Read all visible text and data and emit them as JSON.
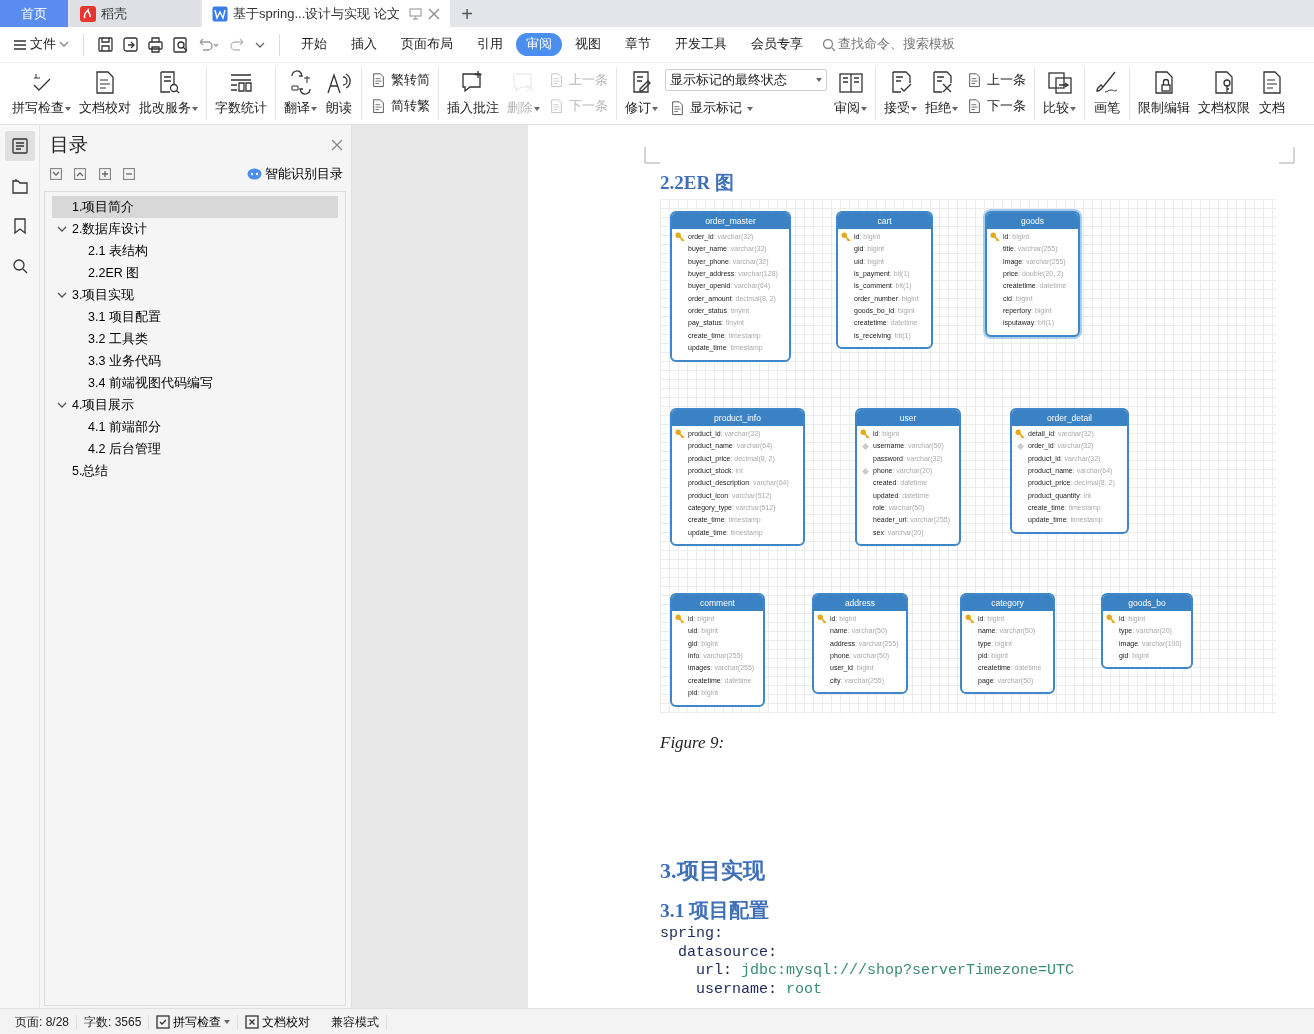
{
  "tabs": [
    {
      "label": "首页",
      "kind": "home",
      "selected": false
    },
    {
      "label": "稻壳",
      "kind": "app",
      "selected": false
    },
    {
      "label": "基于spring...设计与实现 论文",
      "kind": "doc",
      "selected": true
    }
  ],
  "new_tab": "+",
  "menu": {
    "file": "文件",
    "tabs": [
      {
        "label": "开始",
        "selected": false
      },
      {
        "label": "插入",
        "selected": false
      },
      {
        "label": "页面布局",
        "selected": false
      },
      {
        "label": "引用",
        "selected": false
      },
      {
        "label": "审阅",
        "selected": true
      },
      {
        "label": "视图",
        "selected": false
      },
      {
        "label": "章节",
        "selected": false
      },
      {
        "label": "开发工具",
        "selected": false
      },
      {
        "label": "会员专享",
        "selected": false
      }
    ],
    "search_placeholder": "查找命令、搜索模板"
  },
  "ribbon": [
    {
      "items": [
        {
          "kind": "large",
          "label": "拼写检查",
          "dropdown": true,
          "disabled": false
        },
        {
          "kind": "large",
          "label": "文档校对",
          "dropdown": false,
          "disabled": false
        },
        {
          "kind": "large",
          "label": "批改服务",
          "dropdown": true,
          "disabled": false
        }
      ]
    },
    {
      "items": [
        {
          "kind": "large",
          "label": "字数统计",
          "dropdown": false,
          "disabled": false
        }
      ]
    },
    {
      "items": [
        {
          "kind": "large",
          "label": "翻译",
          "dropdown": true,
          "disabled": false
        },
        {
          "kind": "large",
          "label": "朗读",
          "dropdown": false,
          "disabled": false
        }
      ]
    },
    {
      "items": [
        {
          "kind": "pair",
          "items": [
            {
              "label": "繁转简",
              "dropdown": false,
              "disabled": false
            },
            {
              "label": "简转繁",
              "dropdown": false,
              "disabled": false
            }
          ]
        }
      ]
    },
    {
      "items": [
        {
          "kind": "large",
          "label": "插入批注",
          "dropdown": false,
          "disabled": false
        },
        {
          "kind": "large",
          "label": "删除",
          "dropdown": true,
          "disabled": true
        },
        {
          "kind": "pair",
          "items": [
            {
              "label": "上一条",
              "dropdown": false,
              "disabled": true
            },
            {
              "label": "下一条",
              "dropdown": false,
              "disabled": true
            }
          ]
        }
      ]
    },
    {
      "items": [
        {
          "kind": "large",
          "label": "修订",
          "dropdown": true,
          "disabled": false
        },
        {
          "kind": "select",
          "value": "显示标记的最终状态",
          "item": {
            "label": "显示标记",
            "dropdown": true,
            "disabled": false
          }
        },
        {
          "kind": "large",
          "label": "审阅",
          "dropdown": true,
          "disabled": false
        }
      ]
    },
    {
      "items": [
        {
          "kind": "large",
          "label": "接受",
          "dropdown": true,
          "disabled": false
        },
        {
          "kind": "large",
          "label": "拒绝",
          "dropdown": true,
          "disabled": false
        },
        {
          "kind": "pair",
          "items": [
            {
              "label": "上一条",
              "dropdown": false,
              "disabled": false
            },
            {
              "label": "下一条",
              "dropdown": false,
              "disabled": false
            }
          ]
        }
      ]
    },
    {
      "items": [
        {
          "kind": "large",
          "label": "比较",
          "dropdown": true,
          "disabled": false
        }
      ]
    },
    {
      "items": [
        {
          "kind": "large",
          "label": "画笔",
          "dropdown": false,
          "disabled": false
        }
      ]
    },
    {
      "items": [
        {
          "kind": "large",
          "label": "限制编辑",
          "dropdown": false,
          "disabled": false
        },
        {
          "kind": "large",
          "label": "文档权限",
          "dropdown": false,
          "disabled": false
        },
        {
          "kind": "large",
          "label": "文档",
          "dropdown": false,
          "disabled": false
        }
      ]
    }
  ],
  "rail": [
    {
      "selected": true
    },
    {
      "selected": false
    },
    {
      "selected": false
    },
    {
      "selected": false
    }
  ],
  "sidebar": {
    "title": "目录",
    "smart_toc": "智能识别目录",
    "toc": [
      {
        "label": "1.项目简介",
        "selected": true
      },
      {
        "label": "2.数据库设计",
        "selected": false,
        "expanded": true,
        "children": [
          {
            "label": "2.1 表结构",
            "selected": false
          },
          {
            "label": "2.2ER 图",
            "selected": false
          }
        ]
      },
      {
        "label": "3.项目实现",
        "selected": false,
        "expanded": true,
        "children": [
          {
            "label": "3.1 项目配置",
            "selected": false
          },
          {
            "label": "3.2 工具类",
            "selected": false
          },
          {
            "label": "3.3 业务代码",
            "selected": false
          },
          {
            "label": "3.4 前端视图代码编写",
            "selected": false
          }
        ]
      },
      {
        "label": "4.项目展示",
        "selected": false,
        "expanded": true,
        "children": [
          {
            "label": "4.1 前端部分",
            "selected": false
          },
          {
            "label": "4.2 后台管理",
            "selected": false
          }
        ]
      },
      {
        "label": "5.总结",
        "selected": false
      }
    ]
  },
  "document": {
    "heading": "2.2ER 图",
    "diagram": {
      "tables": [
        {
          "name": "order_master",
          "selected": false,
          "fields": [
            {
              "name": "order_id",
              "type": ": varchar(32)",
              "kind": "primary"
            },
            {
              "name": "buyer_name",
              "type": ": varchar(32)",
              "kind": "plain"
            },
            {
              "name": "buyer_phone",
              "type": ": varchar(32)",
              "kind": "plain"
            },
            {
              "name": "buyer_address",
              "type": ": varchar(128)",
              "kind": "plain"
            },
            {
              "name": "buyer_openid",
              "type": ": varchar(64)",
              "kind": "plain"
            },
            {
              "name": "order_amount",
              "type": ": decimal(8, 2)",
              "kind": "plain"
            },
            {
              "name": "order_status",
              "type": ": tinyint",
              "kind": "plain"
            },
            {
              "name": "pay_status",
              "type": ": tinyint",
              "kind": "plain"
            },
            {
              "name": "create_time",
              "type": ": timestamp",
              "kind": "plain"
            },
            {
              "name": "update_time",
              "type": ": timestamp",
              "kind": "plain"
            }
          ]
        },
        {
          "name": "cart",
          "selected": false,
          "fields": [
            {
              "name": "id",
              "type": ": bigint",
              "kind": "primary"
            },
            {
              "name": "gid",
              "type": ": bigint",
              "kind": "plain"
            },
            {
              "name": "uid",
              "type": ": bigint",
              "kind": "plain"
            },
            {
              "name": "is_payment",
              "type": ": bit(1)",
              "kind": "plain"
            },
            {
              "name": "is_comment",
              "type": ": bit(1)",
              "kind": "plain"
            },
            {
              "name": "order_number",
              "type": ": bigint",
              "kind": "plain"
            },
            {
              "name": "goods_bo_id",
              "type": ": bigint",
              "kind": "plain"
            },
            {
              "name": "createtime",
              "type": ": datetime",
              "kind": "plain"
            },
            {
              "name": "is_receiving",
              "type": ": bit(1)",
              "kind": "plain"
            }
          ]
        },
        {
          "name": "goods",
          "selected": true,
          "fields": [
            {
              "name": "id",
              "type": ": bigint",
              "kind": "primary"
            },
            {
              "name": "title",
              "type": ": varchar(255)",
              "kind": "plain"
            },
            {
              "name": "image",
              "type": ": varchar(255)",
              "kind": "plain"
            },
            {
              "name": "price",
              "type": ": double(20, 2)",
              "kind": "plain"
            },
            {
              "name": "createtime",
              "type": ": datetime",
              "kind": "plain"
            },
            {
              "name": "cid",
              "type": ": bigint",
              "kind": "plain"
            },
            {
              "name": "repertory",
              "type": ": bigint",
              "kind": "plain"
            },
            {
              "name": "isputaway",
              "type": ": bit(1)",
              "kind": "plain"
            }
          ]
        },
        {
          "name": "product_info",
          "selected": false,
          "fields": [
            {
              "name": "product_id",
              "type": ": varchar(32)",
              "kind": "primary"
            },
            {
              "name": "product_name",
              "type": ": varchar(64)",
              "kind": "plain"
            },
            {
              "name": "product_price",
              "type": ": decimal(8, 2)",
              "kind": "plain"
            },
            {
              "name": "product_stock",
              "type": ": int",
              "kind": "plain"
            },
            {
              "name": "product_description",
              "type": ": varchar(64)",
              "kind": "plain"
            },
            {
              "name": "product_icon",
              "type": ": varchar(512)",
              "kind": "plain"
            },
            {
              "name": "category_type",
              "type": ": varchar(512)",
              "kind": "plain"
            },
            {
              "name": "create_time",
              "type": ": timestamp",
              "kind": "plain"
            },
            {
              "name": "update_time",
              "type": ": timestamp",
              "kind": "plain"
            }
          ]
        },
        {
          "name": "user",
          "selected": false,
          "fields": [
            {
              "name": "id",
              "type": ": bigint",
              "kind": "primary"
            },
            {
              "name": "username",
              "type": ": varchar(50)",
              "kind": "index"
            },
            {
              "name": "password",
              "type": ": varchar(32)",
              "kind": "plain"
            },
            {
              "name": "phone",
              "type": ": varchar(20)",
              "kind": "index"
            },
            {
              "name": "created",
              "type": ": datetime",
              "kind": "plain"
            },
            {
              "name": "updated",
              "type": ": datetime",
              "kind": "plain"
            },
            {
              "name": "role",
              "type": ": varchar(50)",
              "kind": "plain"
            },
            {
              "name": "header_url",
              "type": ": varchar(255)",
              "kind": "plain"
            },
            {
              "name": "sex",
              "type": ": varchar(20)",
              "kind": "plain"
            }
          ]
        },
        {
          "name": "order_detail",
          "selected": false,
          "fields": [
            {
              "name": "detail_id",
              "type": ": varchar(32)",
              "kind": "primary"
            },
            {
              "name": "order_id",
              "type": ": varchar(32)",
              "kind": "index"
            },
            {
              "name": "product_id",
              "type": ": varchar(32)",
              "kind": "plain"
            },
            {
              "name": "product_name",
              "type": ": varchar(64)",
              "kind": "plain"
            },
            {
              "name": "product_price",
              "type": ": decimal(8, 2)",
              "kind": "plain"
            },
            {
              "name": "product_quantity",
              "type": ": int",
              "kind": "plain"
            },
            {
              "name": "create_time",
              "type": ": timestamp",
              "kind": "plain"
            },
            {
              "name": "update_time",
              "type": ": timestamp",
              "kind": "plain"
            }
          ]
        },
        {
          "name": "comment",
          "selected": false,
          "fields": [
            {
              "name": "id",
              "type": ": bigint",
              "kind": "primary"
            },
            {
              "name": "uid",
              "type": ": bigint",
              "kind": "plain"
            },
            {
              "name": "gid",
              "type": ": bigint",
              "kind": "plain"
            },
            {
              "name": "info",
              "type": ": varchar(255)",
              "kind": "plain"
            },
            {
              "name": "images",
              "type": ": varchar(255)",
              "kind": "plain"
            },
            {
              "name": "createtime",
              "type": ": datetime",
              "kind": "plain"
            },
            {
              "name": "pid",
              "type": ": bigint",
              "kind": "plain"
            }
          ]
        },
        {
          "name": "address",
          "selected": false,
          "fields": [
            {
              "name": "id",
              "type": ": bigint",
              "kind": "primary"
            },
            {
              "name": "name",
              "type": ": varchar(50)",
              "kind": "plain"
            },
            {
              "name": "address",
              "type": ": varchar(255)",
              "kind": "plain"
            },
            {
              "name": "phone",
              "type": ": varchar(50)",
              "kind": "plain"
            },
            {
              "name": "user_id",
              "type": ": bigint",
              "kind": "plain"
            },
            {
              "name": "city",
              "type": ": varchar(255)",
              "kind": "plain"
            }
          ]
        },
        {
          "name": "category",
          "selected": false,
          "fields": [
            {
              "name": "id",
              "type": ": bigint",
              "kind": "primary"
            },
            {
              "name": "name",
              "type": ": varchar(50)",
              "kind": "plain"
            },
            {
              "name": "type",
              "type": ": bigint",
              "kind": "plain"
            },
            {
              "name": "pid",
              "type": ": bigint",
              "kind": "plain"
            },
            {
              "name": "createtime",
              "type": ": datetime",
              "kind": "plain"
            },
            {
              "name": "page",
              "type": ": varchar(50)",
              "kind": "plain"
            }
          ]
        },
        {
          "name": "goods_bo",
          "selected": false,
          "fields": [
            {
              "name": "id",
              "type": ": bigint",
              "kind": "primary"
            },
            {
              "name": "type",
              "type": ": varchar(20)",
              "kind": "plain"
            },
            {
              "name": "image",
              "type": ": varchar(100)",
              "kind": "plain"
            },
            {
              "name": "gid",
              "type": ": bigint",
              "kind": "plain"
            }
          ]
        }
      ]
    },
    "caption": "Figure 9:",
    "section": "3.项目实现",
    "subsection": "3.1 项目配置",
    "code": [
      {
        "key": "spring:",
        "children": [
          {
            "key": "datasource:",
            "children": [
              {
                "key": "url:",
                "value": "jdbc:mysql:///shop?serverTimezone=UTC"
              },
              {
                "key": "username:",
                "value": "root"
              }
            ]
          }
        ]
      }
    ]
  },
  "status_bar": {
    "page": "页面: 8/28",
    "words": "字数: 3565",
    "spell": "拼写检查",
    "proof": "文档校对",
    "mode": "兼容模式"
  }
}
